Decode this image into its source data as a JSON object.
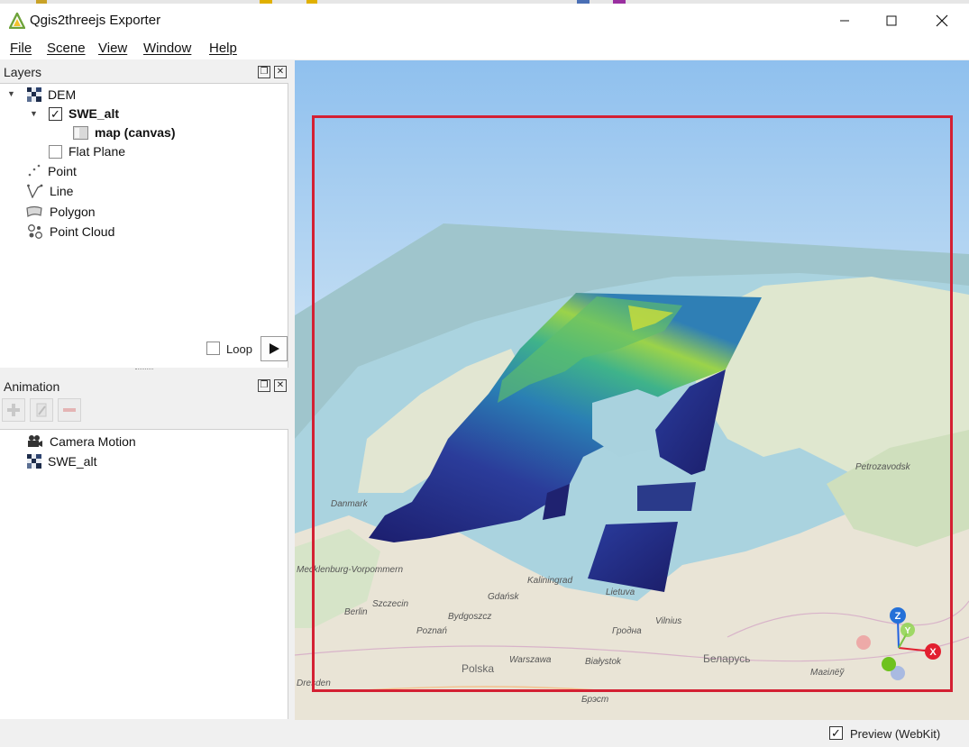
{
  "window": {
    "title": "Qgis2threejs Exporter",
    "controls": {
      "minimize": "minimize",
      "maximize": "maximize",
      "close": "close"
    }
  },
  "menu": [
    "File",
    "Scene",
    "View",
    "Window",
    "Help"
  ],
  "layers_panel": {
    "title": "Layers",
    "tree": [
      {
        "label": "DEM",
        "icon": "dem-icon"
      },
      {
        "label": "SWE_alt",
        "checked": true,
        "bold": true
      },
      {
        "label": "map (canvas)",
        "icon": "map-canvas-icon",
        "bold": true
      },
      {
        "label": "Flat Plane",
        "checked": false
      },
      {
        "label": "Point",
        "icon": "point-icon"
      },
      {
        "label": "Line",
        "icon": "line-icon"
      },
      {
        "label": "Polygon",
        "icon": "polygon-icon"
      },
      {
        "label": "Point Cloud",
        "icon": "point-cloud-icon"
      }
    ]
  },
  "animation_panel": {
    "title": "Animation",
    "loop_label": "Loop",
    "loop_checked": false,
    "items": [
      {
        "label": "Camera Motion",
        "icon": "camera-icon"
      },
      {
        "label": "SWE_alt",
        "icon": "dem-icon"
      }
    ]
  },
  "map_labels": [
    "Petrozavodsk",
    "Danmark",
    "Gdańsk",
    "Szczecin",
    "Berlin",
    "Bydgoszcz",
    "Poznań",
    "Polska",
    "Warszawa",
    "Białystok",
    "Vilnius",
    "Kaliningrad",
    "Lietuva",
    "Беларусь",
    "Гродна",
    "Dresden",
    "Mecklenburg-Vorpommern",
    "Брэст",
    "Магілёў"
  ],
  "axes": {
    "x": "X",
    "y": "Y",
    "z": "Z"
  },
  "status": {
    "preview_label": "Preview (WebKit)",
    "preview_checked": true
  }
}
